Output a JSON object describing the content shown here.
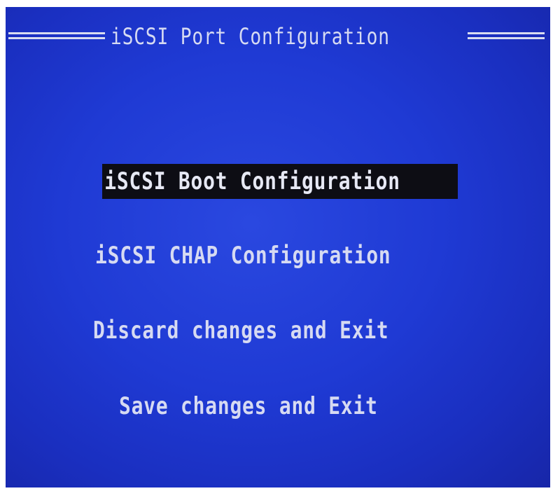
{
  "window": {
    "title": "iSCSI Port Configuration"
  },
  "menu": {
    "selected_index": 0,
    "items": [
      {
        "label": "iSCSI Boot Configuration"
      },
      {
        "label": "iSCSI CHAP Configuration"
      },
      {
        "label": "Discard changes and Exit"
      },
      {
        "label": "Save changes and Exit"
      }
    ]
  },
  "colors": {
    "background": "#1f3ad4",
    "text": "#d6daf2",
    "highlight_background": "#0d0d14"
  }
}
